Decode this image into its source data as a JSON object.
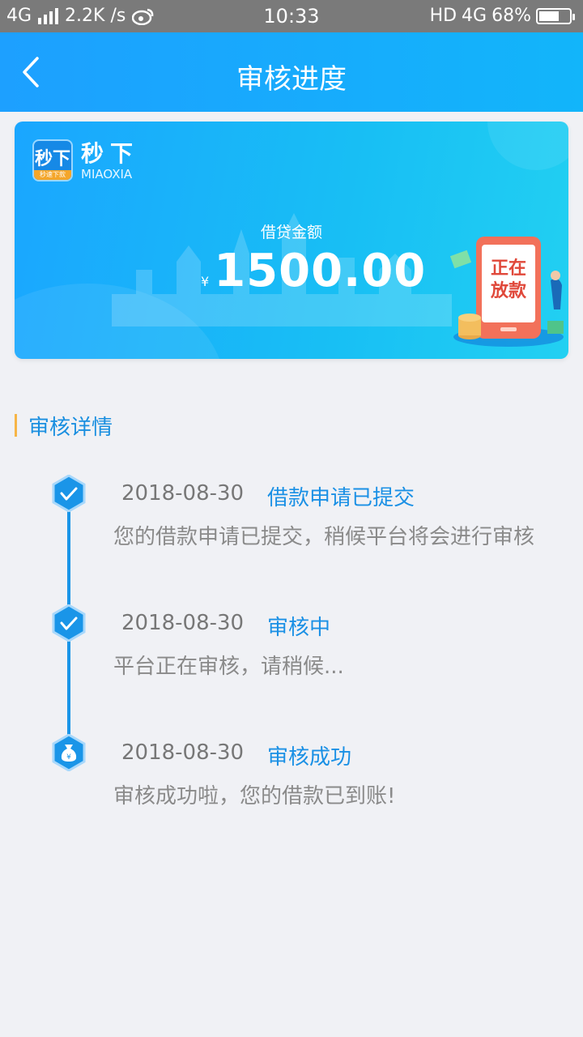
{
  "status_bar": {
    "network": "4G",
    "speed": "2.2K /s",
    "time": "10:33",
    "hd": "HD",
    "network2": "4G",
    "battery": "68%",
    "battery_level": 0.68
  },
  "header": {
    "title": "审核进度"
  },
  "card": {
    "brand_logo_text": "秒下",
    "brand_logo_subtext": "秒速下款",
    "brand_name": "秒下",
    "brand_sub": "MIAOXIA",
    "amount_label": "借贷金额",
    "currency": "¥",
    "amount": "1500.00",
    "illustration_text_line1": "正在",
    "illustration_text_line2": "放款"
  },
  "section": {
    "title": "审核详情"
  },
  "timeline": [
    {
      "date": "2018-08-30",
      "status": "借款申请已提交",
      "desc": "您的借款申请已提交，稍候平台将会进行审核",
      "icon": "check-icon"
    },
    {
      "date": "2018-08-30",
      "status": "审核中",
      "desc": "平台正在审核，请稍候...",
      "icon": "check-icon"
    },
    {
      "date": "2018-08-30",
      "status": "审核成功",
      "desc": "审核成功啦，您的借款已到账!",
      "icon": "money-bag-icon"
    }
  ],
  "colors": {
    "primary": "#1da0ff",
    "accent": "#f6b546",
    "status_text": "#1a90e5"
  }
}
